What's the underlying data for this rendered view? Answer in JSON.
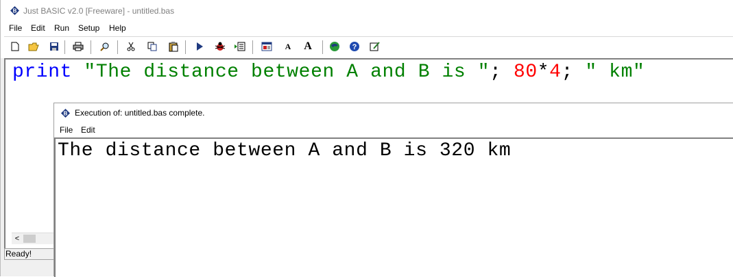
{
  "main_window": {
    "title": "Just BASIC v2.0 [Freeware] - untitled.bas",
    "menu": [
      "File",
      "Edit",
      "Run",
      "Setup",
      "Help"
    ],
    "toolbar": {
      "buttons": [
        "new-file-icon",
        "open-folder-icon",
        "save-icon",
        "print-icon",
        "find-icon",
        "cut-icon",
        "copy-icon",
        "paste-icon",
        "run-icon",
        "debug-icon",
        "lite-debug-icon",
        "gui-editor-icon",
        "font-small-icon",
        "font-large-icon",
        "web-icon",
        "help-icon",
        "notepad-icon"
      ],
      "font_small_label": "A",
      "font_large_label": "A"
    },
    "editor": {
      "code_tokens": {
        "keyword": "print",
        "string1": "\"The distance between A and B is \"",
        "semi1": ";",
        "num1": "80",
        "op": "*",
        "num2": "4",
        "semi2": ";",
        "string2": "\" km\""
      }
    },
    "statusbar": {
      "text": "Ready!"
    },
    "scroll_left_glyph": "<"
  },
  "exec_window": {
    "title": "Execution of: untitled.bas complete.",
    "menu": [
      "File",
      "Edit"
    ],
    "output": "The distance between A and B is 320 km"
  },
  "colors": {
    "keyword": "#0000ff",
    "string": "#008000",
    "number": "#ff0000"
  }
}
